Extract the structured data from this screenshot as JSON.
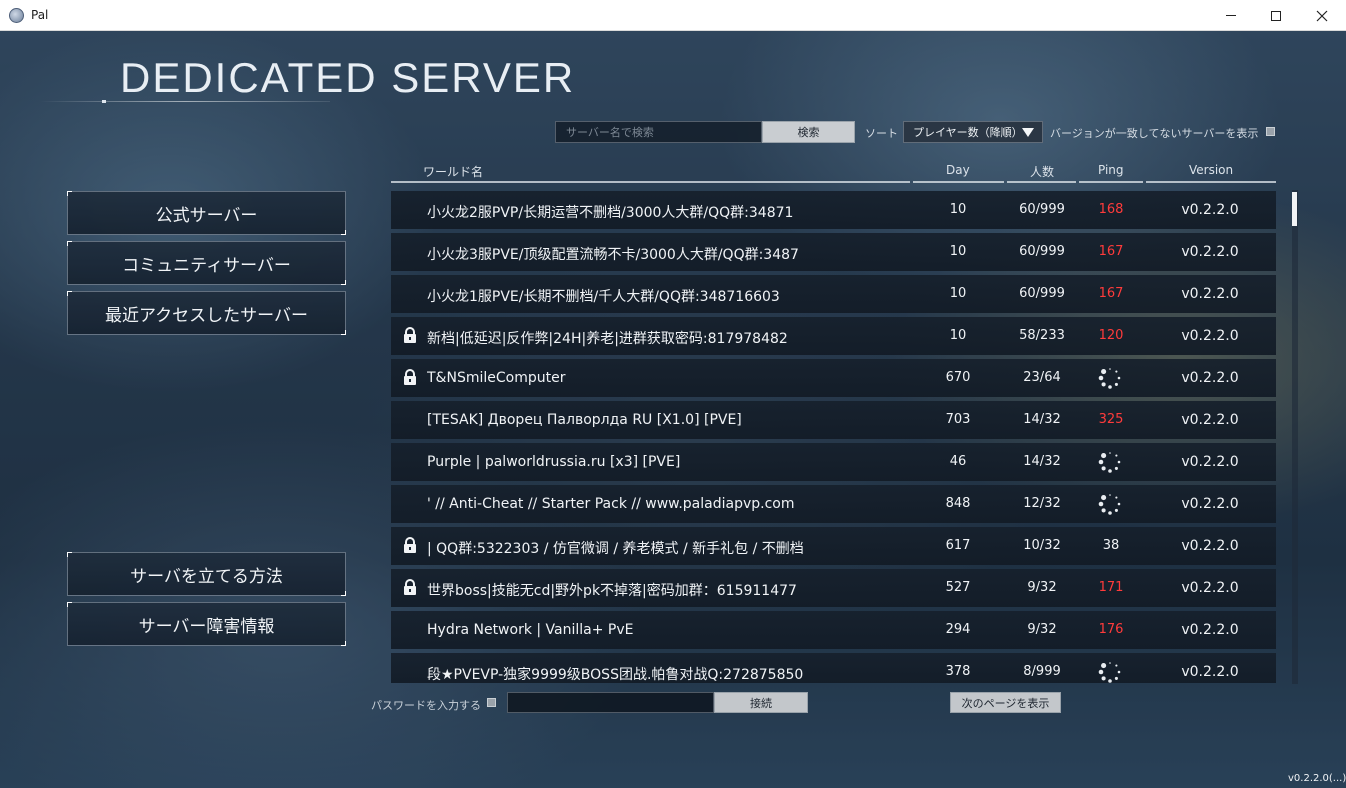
{
  "window": {
    "title": "Pal",
    "controls": {
      "minimize_icon": "minimize-icon",
      "maximize_icon": "maximize-icon",
      "close_icon": "close-icon"
    }
  },
  "header": {
    "title": "DEDICATED SERVER"
  },
  "menu": {
    "official": "公式サーバー",
    "community": "コミュニティサーバー",
    "recent": "最近アクセスしたサーバー",
    "howto": "サーバを立てる方法",
    "outage": "サーバー障害情報"
  },
  "search": {
    "placeholder": "サーバー名で検索",
    "button": "検索",
    "sort_label": "ソート",
    "sort_value": "プレイヤー数（降順）",
    "version_filter": "バージョンが一致してないサーバーを表示",
    "version_filter_checked": false
  },
  "table": {
    "columns": {
      "name": "ワールド名",
      "day": "Day",
      "players": "人数",
      "ping": "Ping",
      "version": "Version"
    },
    "rows": [
      {
        "locked": false,
        "name": "小火龙2服PVP/长期运营不删档/3000人大群/QQ群:34871",
        "day": "10",
        "players": "60/999",
        "ping": "168",
        "ping_status": "bad",
        "version": "v0.2.2.0"
      },
      {
        "locked": false,
        "name": "小火龙3服PVE/顶级配置流畅不卡/3000人大群/QQ群:3487",
        "day": "10",
        "players": "60/999",
        "ping": "167",
        "ping_status": "bad",
        "version": "v0.2.2.0"
      },
      {
        "locked": false,
        "name": "小火龙1服PVE/长期不删档/千人大群/QQ群:348716603",
        "day": "10",
        "players": "60/999",
        "ping": "167",
        "ping_status": "bad",
        "version": "v0.2.2.0"
      },
      {
        "locked": true,
        "name": "新档|低延迟|反作弊|24H|养老|进群获取密码:817978482",
        "day": "10",
        "players": "58/233",
        "ping": "120",
        "ping_status": "bad",
        "version": "v0.2.2.0"
      },
      {
        "locked": true,
        "name": "T&NSmileComputer",
        "day": "670",
        "players": "23/64",
        "ping": "",
        "ping_status": "loading",
        "version": "v0.2.2.0"
      },
      {
        "locked": false,
        "name": "[TESAK] Дворец Палворлда RU [X1.0] [PVE]",
        "day": "703",
        "players": "14/32",
        "ping": "325",
        "ping_status": "bad",
        "version": "v0.2.2.0"
      },
      {
        "locked": false,
        "name": "Purple | palworldrussia.ru [x3] [PVE]",
        "day": "46",
        "players": "14/32",
        "ping": "",
        "ping_status": "loading",
        "version": "v0.2.2.0"
      },
      {
        "locked": false,
        "name": "' // Anti-Cheat // Starter Pack // www.paladiapvp.com",
        "day": "848",
        "players": "12/32",
        "ping": "",
        "ping_status": "loading",
        "version": "v0.2.2.0"
      },
      {
        "locked": true,
        "name": "| QQ群:5322303 / 仿官微调 / 养老模式 / 新手礼包 / 不删档",
        "day": "617",
        "players": "10/32",
        "ping": "38",
        "ping_status": "good",
        "version": "v0.2.2.0"
      },
      {
        "locked": true,
        "name": "世界boss|技能无cd|野外pk不掉落|密码加群：615911477",
        "day": "527",
        "players": "9/32",
        "ping": "171",
        "ping_status": "bad",
        "version": "v0.2.2.0"
      },
      {
        "locked": false,
        "name": "Hydra Network | Vanilla+ PvE",
        "day": "294",
        "players": "9/32",
        "ping": "176",
        "ping_status": "bad",
        "version": "v0.2.2.0"
      },
      {
        "locked": false,
        "name": "段★PVEVP-独家9999级BOSS团战.帕鲁对战Q:272875850",
        "day": "378",
        "players": "8/999",
        "ping": "",
        "ping_status": "loading",
        "version": "v0.2.2.0"
      }
    ]
  },
  "bottom": {
    "password_label": "パスワードを入力する",
    "password_checked": false,
    "connect": "接続",
    "next_page": "次のページを表示"
  },
  "build_version": "v0.2.2.0(...)",
  "colors": {
    "ping_bad": "#ff3b3b",
    "ping_good": "#f0f3f6"
  }
}
